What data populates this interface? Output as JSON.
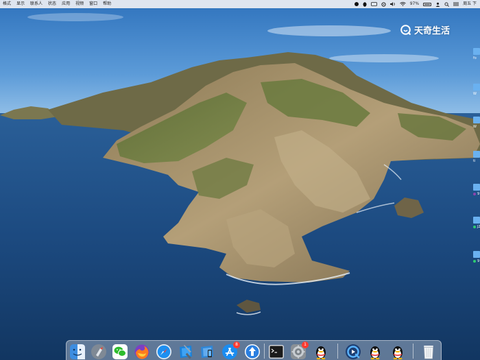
{
  "menubar": {
    "items": [
      "格式",
      "显示",
      "联系人",
      "状态",
      "应用",
      "视频",
      "窗口",
      "帮助"
    ],
    "battery_percent": "97%",
    "clock": "周五 下"
  },
  "watermark": {
    "text": "天奇生活"
  },
  "desktop_items": [
    {
      "label": "fo",
      "tag_color": ""
    },
    {
      "label": "W",
      "tag_color": ""
    },
    {
      "label": "W",
      "tag_color": ""
    },
    {
      "label": "ti",
      "tag_color": ""
    },
    {
      "label": "9",
      "tag_color": "#8e44ad"
    },
    {
      "label": "JZ",
      "tag_color": "#2ecc71"
    },
    {
      "label": "9",
      "tag_color": "#2ecc71"
    }
  ],
  "dock": {
    "items": [
      {
        "name": "finder-icon",
        "badge": ""
      },
      {
        "name": "launchpad-icon",
        "badge": ""
      },
      {
        "name": "wechat-icon",
        "badge": ""
      },
      {
        "name": "firefox-icon",
        "badge": ""
      },
      {
        "name": "safari-icon",
        "badge": ""
      },
      {
        "name": "xcode-icon",
        "badge": ""
      },
      {
        "name": "simulator-icon",
        "badge": ""
      },
      {
        "name": "app-store-icon",
        "badge": "8"
      },
      {
        "name": "software-update-icon",
        "badge": ""
      },
      {
        "name": "terminal-icon",
        "badge": ""
      },
      {
        "name": "system-preferences-icon",
        "badge": "1"
      },
      {
        "name": "qq-icon",
        "badge": ""
      },
      {
        "name": "quicktime-icon",
        "badge": ""
      },
      {
        "name": "qq-icon-2",
        "badge": ""
      },
      {
        "name": "qq-icon-3",
        "badge": ""
      },
      {
        "name": "trash-icon",
        "badge": ""
      }
    ]
  },
  "colors": {
    "sky": "#4f8fcf",
    "sea": "#1f4f86",
    "island_green": "#6f7d3e",
    "rock": "#a69069"
  }
}
